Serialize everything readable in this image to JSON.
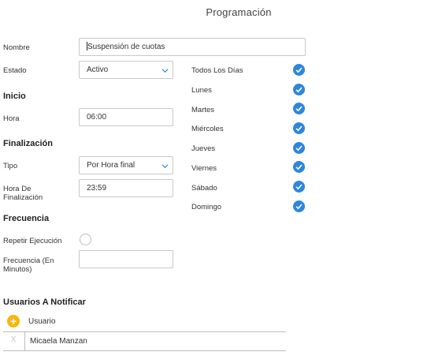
{
  "header": {
    "title": "Programación"
  },
  "form": {
    "nombre_label": "Nombre",
    "nombre_value": "Suspensión de cuotas",
    "estado_label": "Estado",
    "estado_value": "Activo",
    "inicio_title": "Inicio",
    "hora_label": "Hora",
    "hora_value": "06:00",
    "fin_title": "Finalización",
    "tipo_label": "Tipo",
    "tipo_value": "Por Hora final",
    "hora_fin_label_1": "Hora De",
    "hora_fin_label_2": "Finalización",
    "hora_fin_value": "23:59",
    "frecuencia_title": "Frecuencia",
    "repetir_label": "Repetir Ejecución",
    "repetir_checked": false,
    "frec_label_1": "Frecuencia (En",
    "frec_label_2": "Minutos)",
    "frec_value": ""
  },
  "days": [
    {
      "label": "Todos Los Días",
      "checked": true
    },
    {
      "label": "Lunes",
      "checked": true
    },
    {
      "label": "Martes",
      "checked": true
    },
    {
      "label": "Miércoles",
      "checked": true
    },
    {
      "label": "Jueves",
      "checked": true
    },
    {
      "label": "Viernes",
      "checked": true
    },
    {
      "label": "Sábado",
      "checked": true
    },
    {
      "label": "Domingo",
      "checked": true
    }
  ],
  "users": {
    "title": "Usuarios A Notificar",
    "add_glyph": "+",
    "column_header": "Usuario",
    "remove_glyph": "X",
    "rows": [
      {
        "name": "Micaela Manzan"
      }
    ]
  },
  "colors": {
    "accent": "#2e86de",
    "add_button": "#f5b70c"
  },
  "icons": {
    "check": "check-circle-icon",
    "chevron": "chevron-down-icon",
    "add": "plus-circle-icon",
    "remove": "close-icon"
  }
}
